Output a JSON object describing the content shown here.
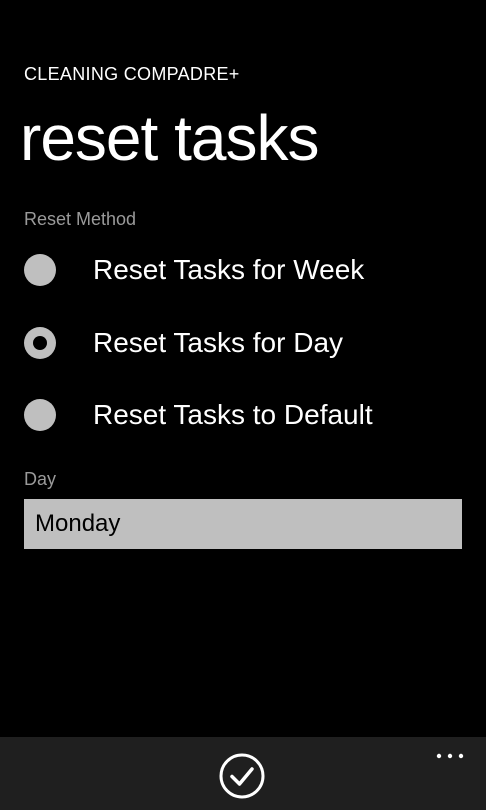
{
  "header": {
    "app_title": "CLEANING COMPADRE+",
    "page_title": "reset tasks"
  },
  "reset_method": {
    "label": "Reset Method",
    "selected": "Reset Tasks for Day",
    "options": [
      {
        "label": "Reset Tasks for Week",
        "checked": false
      },
      {
        "label": "Reset Tasks for Day",
        "checked": true
      },
      {
        "label": "Reset Tasks to Default",
        "checked": false
      }
    ]
  },
  "day": {
    "label": "Day",
    "value": "Monday"
  },
  "app_bar": {
    "buttons": [
      {
        "icon": "check-icon"
      },
      {
        "icon": "more-options-icon"
      }
    ]
  },
  "colors": {
    "background": "#000000",
    "foreground": "#ffffff",
    "subtle_label": "#9a9a9a",
    "control_fill": "#bfbfbf",
    "app_bar": "#1f1f1f"
  }
}
